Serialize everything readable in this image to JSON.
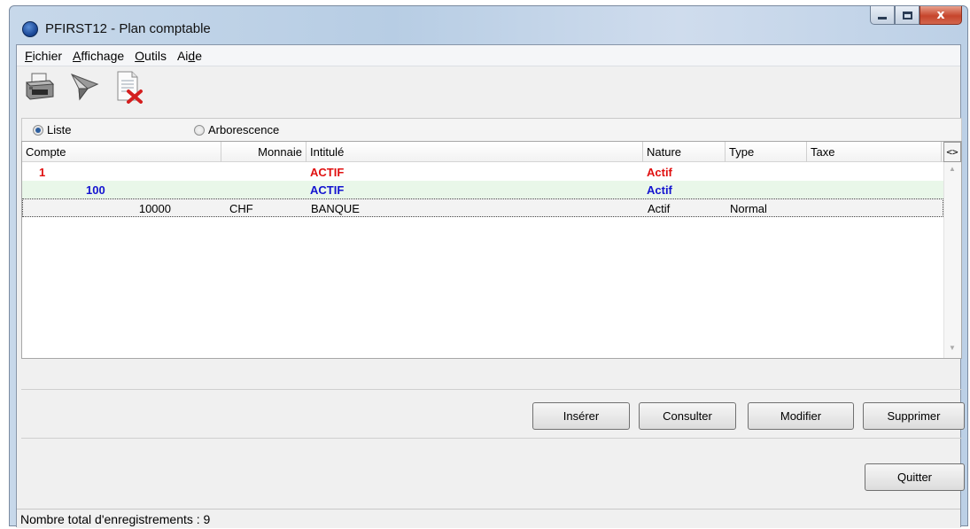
{
  "window": {
    "title": "PFIRST12 - Plan comptable",
    "controls": {
      "minimize": "minimize-icon",
      "maximize": "maximize-icon",
      "close": "close-icon",
      "close_glyph": "x"
    }
  },
  "menu": [
    {
      "label_u": "F",
      "label_rest": "ichier"
    },
    {
      "label_u": "A",
      "label_rest": "ffichage"
    },
    {
      "label_u": "O",
      "label_rest": "utils"
    },
    {
      "label_pre": "Ai",
      "label_u": "d",
      "label_rest": "e"
    }
  ],
  "toolbar": {
    "icons": [
      "printer-icon",
      "filter-icon",
      "delete-document-icon"
    ]
  },
  "view_mode": {
    "options": [
      "Liste",
      "Arborescence"
    ],
    "selected": "Liste"
  },
  "grid": {
    "toggle_label": "<>",
    "columns": [
      "Compte",
      "Monnaie",
      "Intitulé",
      "Nature",
      "Type",
      "Taxe"
    ],
    "rows": [
      {
        "compte": "1",
        "monnaie": "",
        "intitule": "ACTIF",
        "nature": "Actif",
        "type": "",
        "taxe": ""
      },
      {
        "compte": "100",
        "monnaie": "",
        "intitule": "ACTIF",
        "nature": "Actif",
        "type": "",
        "taxe": ""
      },
      {
        "compte": "10000",
        "monnaie": "CHF",
        "intitule": "BANQUE",
        "nature": "Actif",
        "type": "Normal",
        "taxe": ""
      }
    ]
  },
  "buttons": {
    "inserer": "Insérer",
    "consulter": "Consulter",
    "modifier": "Modifier",
    "supprimer": "Supprimer",
    "quitter": "Quitter"
  },
  "status": {
    "text": "Nombre total d'enregistrements : 9"
  },
  "colors": {
    "level1": "#e01010",
    "level2": "#1414d0",
    "level2_bg": "#e9f7e9"
  }
}
